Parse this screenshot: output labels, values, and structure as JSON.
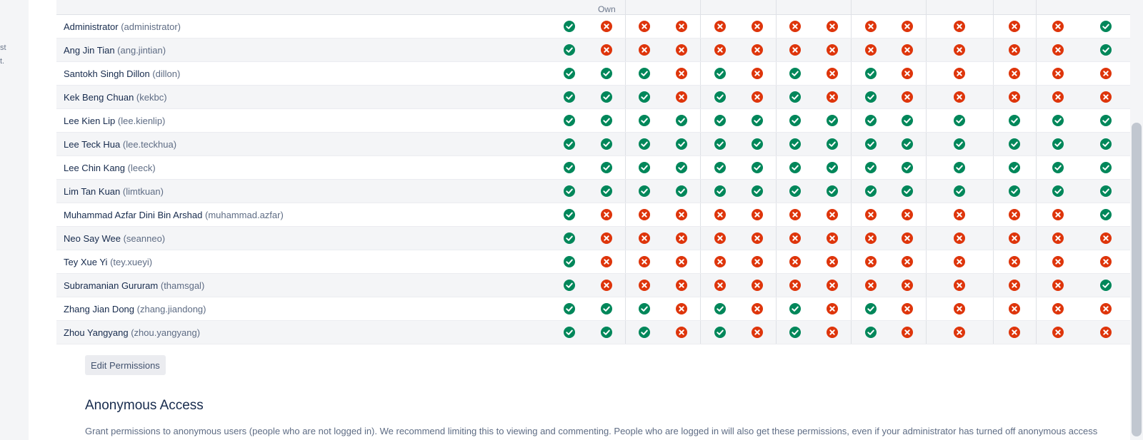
{
  "left_panel_fragments": [
    "st",
    "t."
  ],
  "resize_handle_glyph": "||",
  "column_header": {
    "own": "Own"
  },
  "status_icons": {
    "granted": "check-circle-icon",
    "denied": "cross-circle-icon"
  },
  "colors": {
    "granted": "#00875a",
    "denied": "#de350b",
    "row_alt": "#f4f5f7"
  },
  "users": [
    {
      "name": "Administrator",
      "username": "(administrator)",
      "permissions": [
        1,
        0,
        0,
        0,
        0,
        0,
        0,
        0,
        0,
        0,
        0,
        0,
        0,
        1
      ]
    },
    {
      "name": "Ang Jin Tian",
      "username": "(ang.jintian)",
      "permissions": [
        1,
        0,
        0,
        0,
        0,
        0,
        0,
        0,
        0,
        0,
        0,
        0,
        0,
        1
      ]
    },
    {
      "name": "Santokh Singh Dillon",
      "username": "(dillon)",
      "permissions": [
        1,
        1,
        1,
        0,
        1,
        0,
        1,
        0,
        1,
        0,
        0,
        0,
        0,
        0
      ]
    },
    {
      "name": "Kek Beng Chuan",
      "username": "(kekbc)",
      "permissions": [
        1,
        1,
        1,
        0,
        1,
        0,
        1,
        0,
        1,
        0,
        0,
        0,
        0,
        0
      ]
    },
    {
      "name": "Lee Kien Lip",
      "username": "(lee.kienlip)",
      "permissions": [
        1,
        1,
        1,
        1,
        1,
        1,
        1,
        1,
        1,
        1,
        1,
        1,
        1,
        1
      ]
    },
    {
      "name": "Lee Teck Hua",
      "username": "(lee.teckhua)",
      "permissions": [
        1,
        1,
        1,
        1,
        1,
        1,
        1,
        1,
        1,
        1,
        1,
        1,
        1,
        1
      ]
    },
    {
      "name": "Lee Chin Kang",
      "username": "(leeck)",
      "permissions": [
        1,
        1,
        1,
        1,
        1,
        1,
        1,
        1,
        1,
        1,
        1,
        1,
        1,
        1
      ]
    },
    {
      "name": "Lim Tan Kuan",
      "username": "(limtkuan)",
      "permissions": [
        1,
        1,
        1,
        1,
        1,
        1,
        1,
        1,
        1,
        1,
        1,
        1,
        1,
        1
      ]
    },
    {
      "name": "Muhammad Azfar Dini Bin Arshad",
      "username": "(muhammad.azfar)",
      "permissions": [
        1,
        0,
        0,
        0,
        0,
        0,
        0,
        0,
        0,
        0,
        0,
        0,
        0,
        1
      ]
    },
    {
      "name": "Neo Say Wee",
      "username": "(seanneo)",
      "permissions": [
        1,
        0,
        0,
        0,
        0,
        0,
        0,
        0,
        0,
        0,
        0,
        0,
        0,
        0
      ]
    },
    {
      "name": "Tey Xue Yi",
      "username": "(tey.xueyi)",
      "permissions": [
        1,
        0,
        0,
        0,
        0,
        0,
        0,
        0,
        0,
        0,
        0,
        0,
        0,
        0
      ]
    },
    {
      "name": "Subramanian Gururam",
      "username": "(thamsgal)",
      "permissions": [
        1,
        0,
        0,
        0,
        0,
        0,
        0,
        0,
        0,
        0,
        0,
        0,
        0,
        1
      ]
    },
    {
      "name": "Zhang Jian Dong",
      "username": "(zhang.jiandong)",
      "permissions": [
        1,
        1,
        1,
        0,
        1,
        0,
        1,
        0,
        1,
        0,
        0,
        0,
        0,
        0
      ]
    },
    {
      "name": "Zhou Yangyang",
      "username": "(zhou.yangyang)",
      "permissions": [
        1,
        1,
        1,
        0,
        1,
        0,
        1,
        0,
        1,
        0,
        0,
        0,
        0,
        0
      ]
    }
  ],
  "edit_button_label": "Edit Permissions",
  "anonymous_access": {
    "title": "Anonymous Access",
    "description": "Grant permissions to anonymous users (people who are not logged in). We recommend limiting this to viewing and commenting. People who are logged in will also get these permissions, even if your administrator has turned off anonymous access"
  }
}
